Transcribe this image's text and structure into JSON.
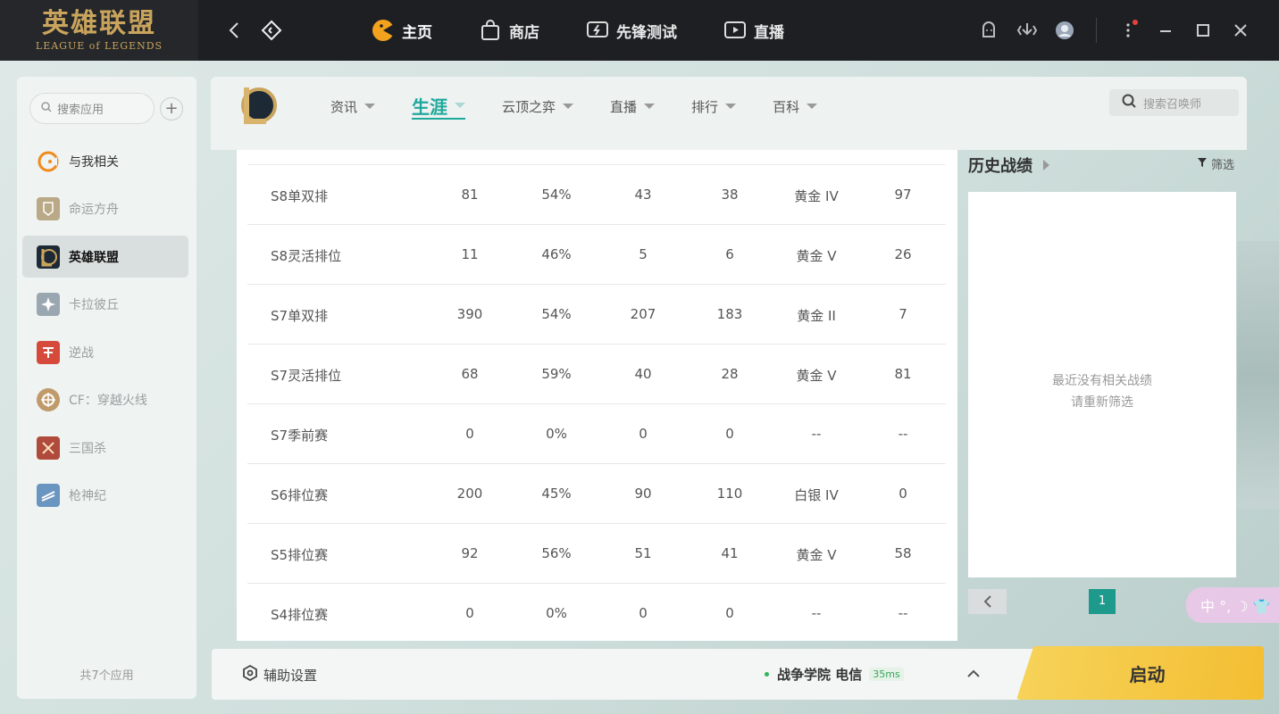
{
  "topbar": {
    "logo_cn": "英雄联盟",
    "logo_en": "LEAGUE of LEGENDS",
    "nav": [
      {
        "label": "主页",
        "icon": "pacman-home-icon"
      },
      {
        "label": "商店",
        "icon": "shopping-bag-icon"
      },
      {
        "label": "先锋测试",
        "icon": "lightning-screen-icon"
      },
      {
        "label": "直播",
        "icon": "play-screen-icon"
      }
    ]
  },
  "sidebar": {
    "search_placeholder": "搜索应用",
    "add_label": "+",
    "items": [
      {
        "label": "与我相关",
        "icon": "related-to-me-icon",
        "color": "#f08a1c"
      },
      {
        "label": "命运方舟",
        "icon": "lost-ark-icon",
        "color": "#b9a987"
      },
      {
        "label": "英雄联盟",
        "icon": "lol-icon",
        "color": "#1d2a36"
      },
      {
        "label": "卡拉彼丘",
        "icon": "strinova-icon",
        "color": "#9aa7b1"
      },
      {
        "label": "逆战",
        "icon": "nizhan-icon",
        "color": "#d64a3c"
      },
      {
        "label": "CF：穿越火线",
        "icon": "crossfire-icon",
        "color": "#c09a6a"
      },
      {
        "label": "三国杀",
        "icon": "sanguosha-icon",
        "color": "#b04a3a"
      },
      {
        "label": "枪神纪",
        "icon": "qiangshenji-icon",
        "color": "#6a95c0"
      }
    ],
    "app_count": "共7个应用"
  },
  "main": {
    "tabs": [
      {
        "label": "资讯"
      },
      {
        "label": "生涯"
      },
      {
        "label": "云顶之弈"
      },
      {
        "label": "直播"
      },
      {
        "label": "排行"
      },
      {
        "label": "百科"
      }
    ],
    "summoner_search_placeholder": "搜索召唤师"
  },
  "rank_table": {
    "rows": [
      {
        "season": "S8单双排",
        "games": "81",
        "winrate": "54%",
        "wins": "43",
        "losses": "38",
        "tier": "黄金 IV",
        "points": "97"
      },
      {
        "season": "S8灵活排位",
        "games": "11",
        "winrate": "46%",
        "wins": "5",
        "losses": "6",
        "tier": "黄金 V",
        "points": "26"
      },
      {
        "season": "S7单双排",
        "games": "390",
        "winrate": "54%",
        "wins": "207",
        "losses": "183",
        "tier": "黄金 II",
        "points": "7"
      },
      {
        "season": "S7灵活排位",
        "games": "68",
        "winrate": "59%",
        "wins": "40",
        "losses": "28",
        "tier": "黄金 V",
        "points": "81"
      },
      {
        "season": "S7季前赛",
        "games": "0",
        "winrate": "0%",
        "wins": "0",
        "losses": "0",
        "tier": "--",
        "points": "--"
      },
      {
        "season": "S6排位赛",
        "games": "200",
        "winrate": "45%",
        "wins": "90",
        "losses": "110",
        "tier": "白银 IV",
        "points": "0"
      },
      {
        "season": "S5排位赛",
        "games": "92",
        "winrate": "56%",
        "wins": "51",
        "losses": "41",
        "tier": "黄金 V",
        "points": "58"
      },
      {
        "season": "S4排位赛",
        "games": "0",
        "winrate": "0%",
        "wins": "0",
        "losses": "0",
        "tier": "--",
        "points": "--"
      }
    ]
  },
  "history": {
    "title": "历史战绩",
    "filter_label": "筛选",
    "empty_line1": "最近没有相关战绩",
    "empty_line2": "请重新筛选",
    "current_page": "1"
  },
  "ime": {
    "label": "中 °, ☽ 👕"
  },
  "bottom": {
    "assist_label": "辅助设置",
    "server": "战争学院 电信",
    "ping": "35ms",
    "launch_label": "启动"
  },
  "colors": {
    "accent": "#1ea89c",
    "launch": "#f4be32",
    "topbar": "#1d1f23",
    "logo_gold": "#c9a45c",
    "online": "#32b45a"
  }
}
